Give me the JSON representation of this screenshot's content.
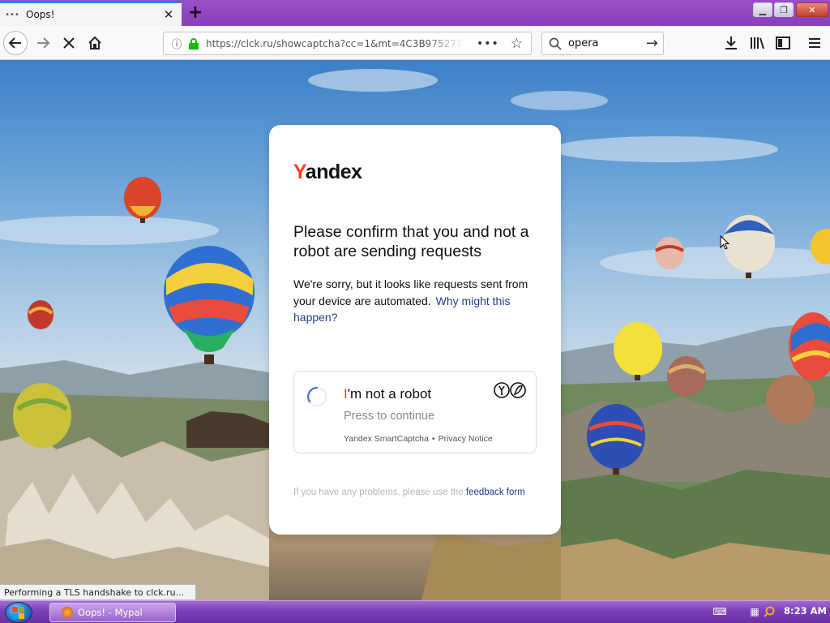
{
  "browser": {
    "tab": {
      "title": "Oops!",
      "favicon": "loading-dots-icon"
    },
    "url": "https://clck.ru/showcaptcha?cc=1&mt=4C3B975277BA",
    "search_query": "opera",
    "status_text": "Performing a TLS handshake to clck.ru..."
  },
  "captcha": {
    "logo": {
      "first_letter": "Y",
      "rest": "andex"
    },
    "heading": "Please confirm that you and not a robot are sending requests",
    "description": "We're sorry, but it looks like requests sent from your device are automated.",
    "why_link": "Why might this happen?",
    "checkbox": {
      "label_first": "I",
      "label_rest": "'m not a robot",
      "sublabel": "Press to continue",
      "product": "Yandex SmartCaptcha",
      "separator": "•",
      "privacy": "Privacy Notice"
    },
    "problems_text": "If you have any problems, please use the",
    "feedback_link": "feedback form"
  },
  "taskbar": {
    "window_button": "Oops! - Mypal",
    "clock": "8:23 AM"
  },
  "colors": {
    "yandex_red": "#fc3f1d",
    "link_blue": "#20408a",
    "titlebar_purple": "#8a40bb"
  }
}
